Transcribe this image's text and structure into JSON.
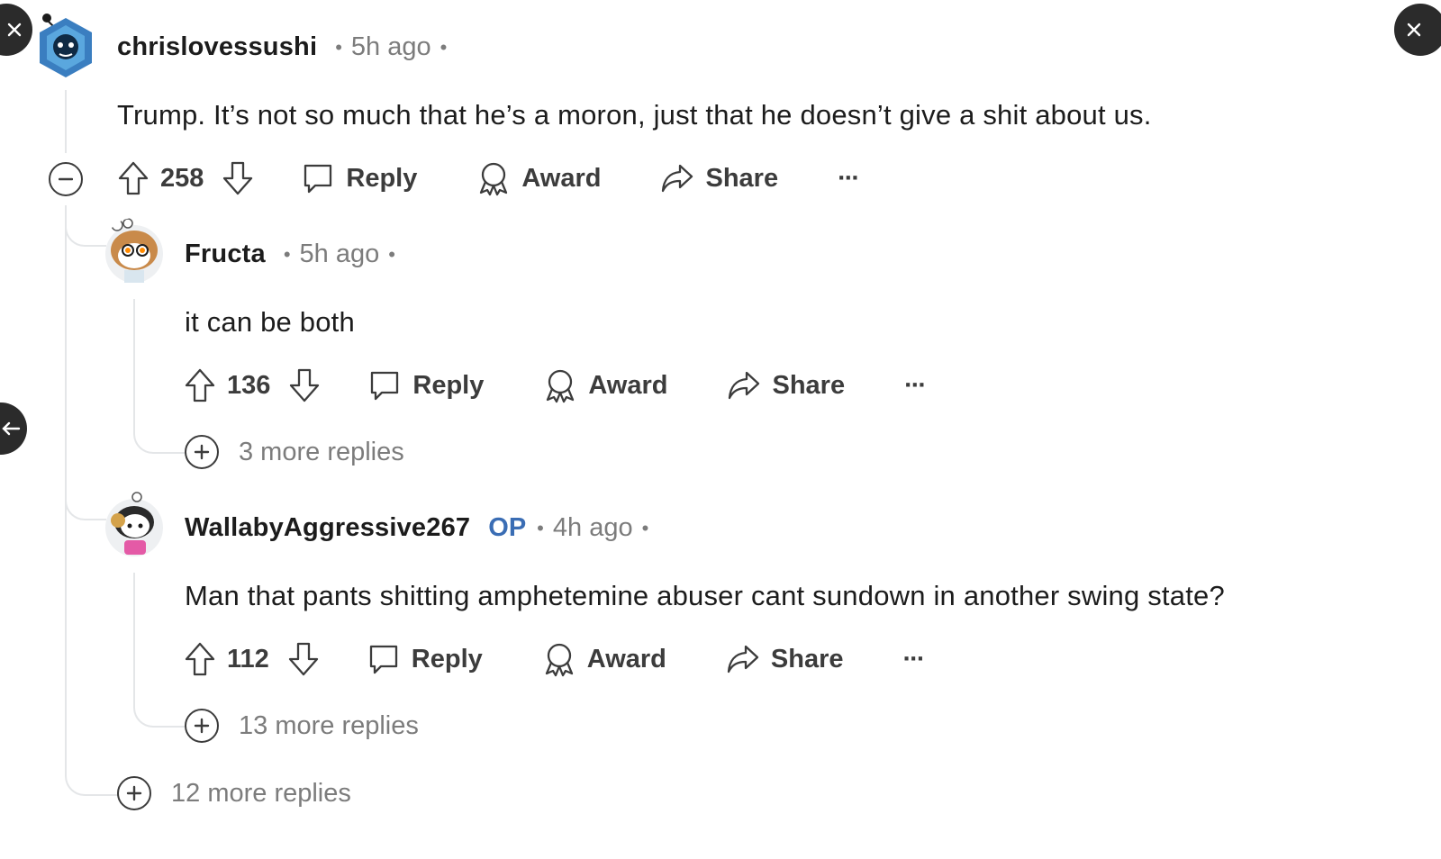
{
  "comments": [
    {
      "author": "chrislovessushi",
      "time": "5h ago",
      "body": "Trump. It’s not so much that he’s a moron, just that he doesn’t give a shit about us.",
      "score": "258",
      "reply_label": "Reply",
      "award_label": "Award",
      "share_label": "Share",
      "more_label": "···"
    },
    {
      "author": "Fructa",
      "time": "5h ago",
      "body": "it can be both",
      "score": "136",
      "reply_label": "Reply",
      "award_label": "Award",
      "share_label": "Share",
      "more_label": "···",
      "more_replies": "3 more replies"
    },
    {
      "author": "WallabyAggressive267",
      "flair": "OP",
      "time": "4h ago",
      "body": "Man that pants shitting amphetemine abuser cant sundown in another swing state?",
      "score": "112",
      "reply_label": "Reply",
      "award_label": "Award",
      "share_label": "Share",
      "more_label": "···",
      "more_replies": "13 more replies"
    }
  ],
  "thread_more_replies": "12 more replies",
  "colors": {
    "text": "#1c1c1c",
    "muted": "#7c7c7c",
    "op": "#3a6db4",
    "thread_line": "#e4e6e8"
  },
  "icons": [
    "close-icon",
    "back-arrow-icon",
    "collapse-icon",
    "upvote-icon",
    "downvote-icon",
    "reply-icon",
    "award-icon",
    "share-icon",
    "expand-icon"
  ]
}
